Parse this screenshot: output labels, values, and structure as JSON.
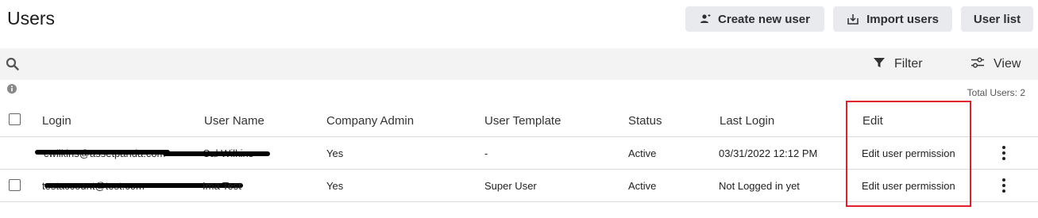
{
  "page": {
    "title": "Users"
  },
  "actions": {
    "create_label": "Create new user",
    "import_label": "Import users",
    "list_label": "User list"
  },
  "toolbar": {
    "filter_label": "Filter",
    "view_label": "View"
  },
  "summary": {
    "total_users": "Total Users: 2"
  },
  "table": {
    "columns": [
      "Login",
      "User Name",
      "Company Admin",
      "User Template",
      "Status",
      "Last Login",
      "Edit"
    ],
    "rows": [
      {
        "login": "cwilkins@assetpanda.com",
        "user_name": "Cal Wilkins",
        "company_admin": "Yes",
        "user_template": "-",
        "status": "Active",
        "last_login": "03/31/2022 12:12 PM",
        "edit": "Edit user permission"
      },
      {
        "login": "testaccount@test.com",
        "user_name": "Ima Test",
        "company_admin": "Yes",
        "user_template": "Super User",
        "status": "Active",
        "last_login": "Not Logged in yet",
        "edit": "Edit user permission"
      }
    ]
  },
  "icons": {
    "create": "add-user-icon",
    "import": "import-icon",
    "search": "search-icon",
    "filter": "filter-icon",
    "view": "sliders-icon",
    "info": "info-icon",
    "more": "kebab-icon"
  },
  "colors": {
    "link": "#2a4aa8",
    "highlight": "#e0202a",
    "button_bg": "#e9eaee"
  }
}
